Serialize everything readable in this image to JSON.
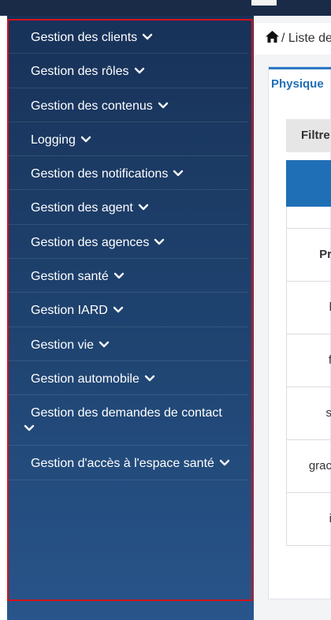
{
  "sidebar": {
    "items": [
      {
        "label": "Gestion des clients"
      },
      {
        "label": "Gestion des rôles"
      },
      {
        "label": "Gestion des contenus"
      },
      {
        "label": "Logging"
      },
      {
        "label": "Gestion des notifications"
      },
      {
        "label": "Gestion des agent"
      },
      {
        "label": "Gestion des agences"
      },
      {
        "label": "Gestion santé"
      },
      {
        "label": "Gestion IARD"
      },
      {
        "label": "Gestion vie"
      },
      {
        "label": "Gestion automobile"
      },
      {
        "label": "Gestion des demandes de contact"
      },
      {
        "label": "Gestion d'accès à l'espace santé"
      }
    ]
  },
  "breadcrumb": {
    "text": "/ Liste de"
  },
  "main": {
    "tab_label": "Physique",
    "filter_label": "Filtre",
    "table": {
      "header_cell": "Pr",
      "cells": [
        "l",
        "f",
        "s",
        "grac",
        "i"
      ]
    }
  },
  "colors": {
    "sidebar_top": "#183259",
    "sidebar_bottom": "#28558b",
    "highlight_border": "#d4121c",
    "accent_blue": "#1f6fb6"
  }
}
